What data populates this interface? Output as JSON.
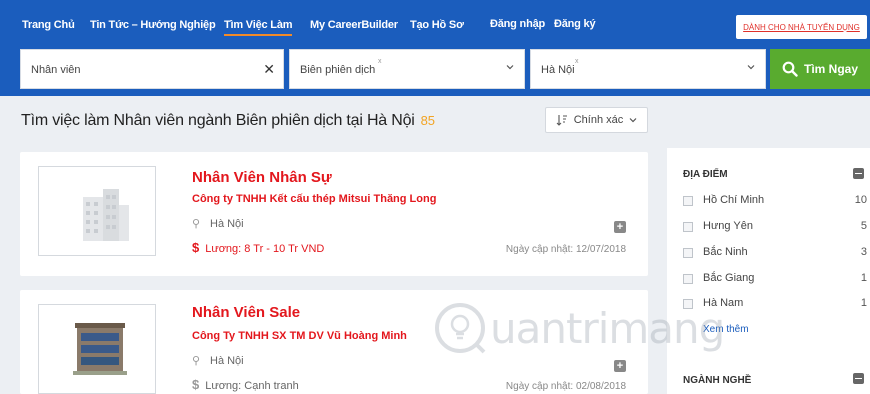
{
  "nav": {
    "items": [
      {
        "label": "Trang Chủ"
      },
      {
        "label": "Tin Tức – Hướng Nghiệp"
      },
      {
        "label": "Tìm Việc Làm"
      },
      {
        "label": "My CareerBuilder"
      },
      {
        "label": "Tạo Hồ Sơ"
      },
      {
        "label": "Đăng nhập"
      },
      {
        "label": "Đăng ký"
      }
    ],
    "active_index": 2,
    "employer_link": "DÀNH CHO NHÀ TUYỂN DỤNG"
  },
  "search": {
    "keyword": "Nhân viên",
    "clear_icon": "close-icon",
    "industry": "Biên phiên dịch",
    "location": "Hà Nội",
    "chip_remove": "x",
    "button_label": "Tìm Ngay",
    "button_icon": "search-icon"
  },
  "results": {
    "title": "Tìm việc làm Nhân viên ngành Biên phiên dịch tại Hà Nội",
    "count": "85",
    "sort_label": "Chính xác"
  },
  "jobs": [
    {
      "title": "Nhân Viên Nhân Sự",
      "company": "Công ty TNHH Kết cấu thép Mitsui Thăng Long",
      "location": "Hà Nội",
      "salary": "Lương: 8 Tr - 10 Tr VND",
      "updated": "Ngày cập nhật: 12/07/2018"
    },
    {
      "title": "Nhân Viên Sale",
      "company": "Công Ty TNHH SX TM DV Vũ Hoàng Minh",
      "location": "Hà Nội",
      "salary": "Lương: Cạnh tranh",
      "updated": "Ngày cập nhật: 02/08/2018"
    }
  ],
  "sidebar": {
    "location_heading": "ĐỊA ĐIỂM",
    "locations": [
      {
        "name": "Hồ Chí Minh",
        "count": "10"
      },
      {
        "name": "Hưng Yên",
        "count": "5"
      },
      {
        "name": "Bắc Ninh",
        "count": "3"
      },
      {
        "name": "Bắc Giang",
        "count": "1"
      },
      {
        "name": "Hà Nam",
        "count": "1"
      }
    ],
    "see_more": "Xem thêm",
    "industry_heading": "NGÀNH NGHỀ"
  },
  "watermark": "uantrimang",
  "colors": {
    "brand_blue": "#1b5dbd",
    "search_green": "#59ab2f",
    "job_red": "#e3171d",
    "count_orange": "#f2a424",
    "active_underline": "#f28a27"
  }
}
